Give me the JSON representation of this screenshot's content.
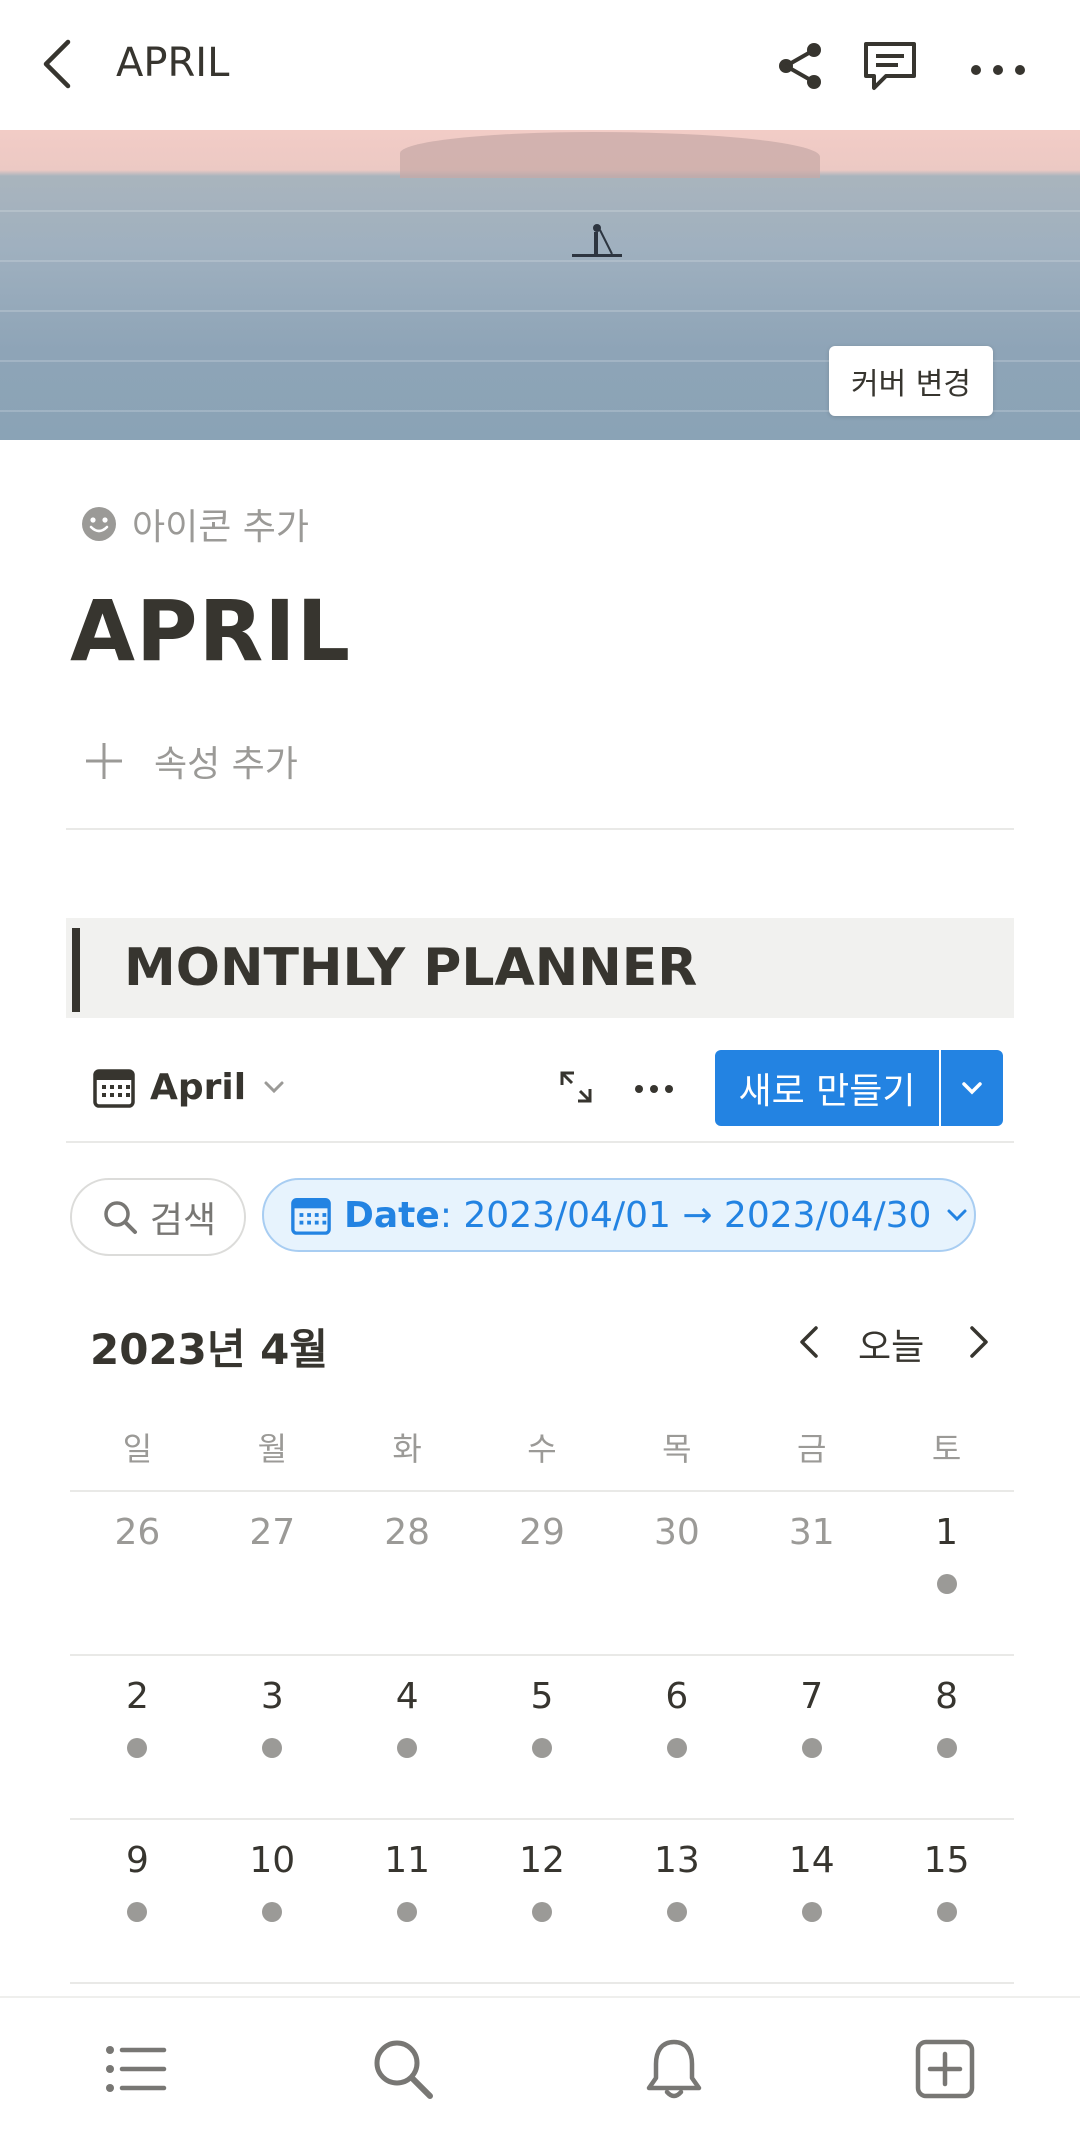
{
  "topbar": {
    "title": "APRIL"
  },
  "cover": {
    "change_label": "커버 변경"
  },
  "header": {
    "add_icon_label": "아이콘 추가",
    "title": "APRIL",
    "add_property_label": "속성 추가"
  },
  "callout": {
    "text": "MONTHLY PLANNER"
  },
  "view": {
    "name": "April",
    "new_button_label": "새로 만들기"
  },
  "filters": {
    "search_label": "검색",
    "date_key": "Date",
    "date_value": ": 2023/04/01 → 2023/04/30"
  },
  "calendar": {
    "month_label": "2023년 4월",
    "today_label": "오늘",
    "weekdays": [
      "일",
      "월",
      "화",
      "수",
      "목",
      "금",
      "토"
    ],
    "weeks": [
      [
        "26",
        "27",
        "28",
        "29",
        "30",
        "31",
        "1"
      ],
      [
        "2",
        "3",
        "4",
        "5",
        "6",
        "7",
        "8"
      ],
      [
        "9",
        "10",
        "11",
        "12",
        "13",
        "14",
        "15"
      ]
    ]
  },
  "colors": {
    "accent": "#2383e2",
    "text": "#37352f",
    "muted": "#9b9a97",
    "callout_bg": "#f1f1ef"
  },
  "icons": {
    "back": "back-arrow-icon",
    "share": "share-icon",
    "comment": "comment-icon",
    "more": "more-horizontal-icon",
    "calendar": "calendar-icon",
    "expand": "expand-icon",
    "search": "search-icon",
    "bottom_nav": [
      "list-icon",
      "search-icon",
      "bell-icon",
      "add-page-icon"
    ]
  }
}
